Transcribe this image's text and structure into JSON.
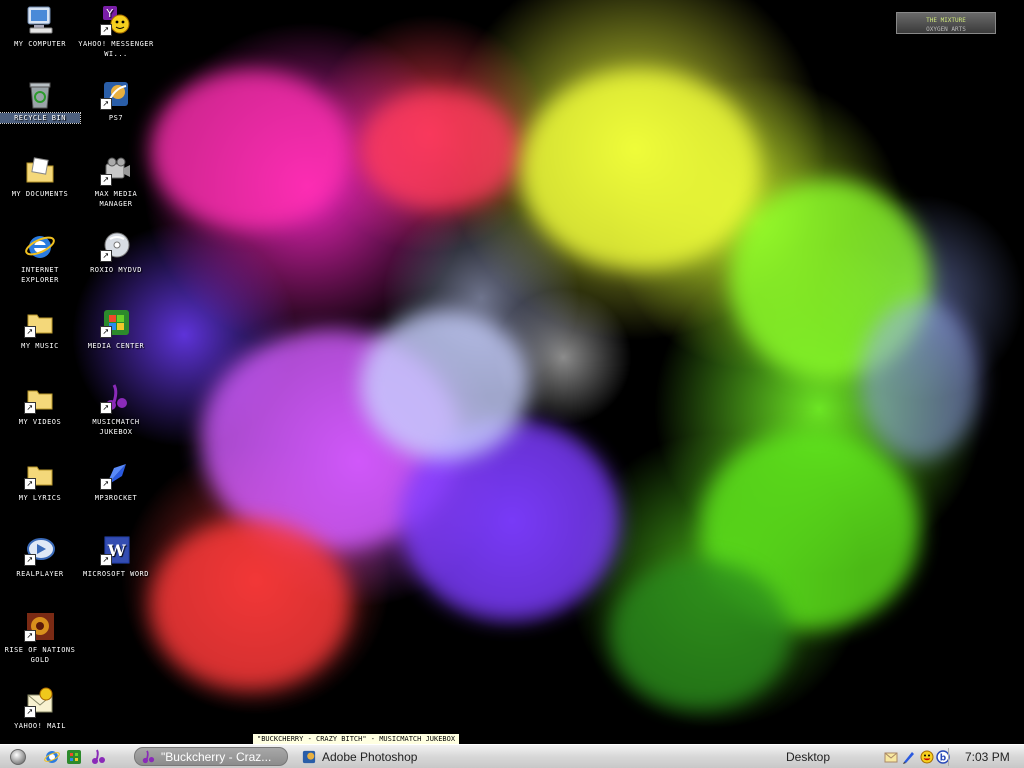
{
  "desktop": {
    "icons": [
      {
        "label": "MY COMPUTER",
        "icon": "computer-icon",
        "shortcut": false
      },
      {
        "label": "YAHOO! MESSENGER WI...",
        "icon": "yahoo-messenger-icon",
        "shortcut": true
      },
      {
        "label": "RECYCLE BIN",
        "icon": "recycle-bin-icon",
        "shortcut": false
      },
      {
        "label": "PS7",
        "icon": "photoshop-icon",
        "shortcut": true
      },
      {
        "label": "MY DOCUMENTS",
        "icon": "folder-documents-icon",
        "shortcut": false
      },
      {
        "label": "MAX MEDIA MANAGER",
        "icon": "media-manager-icon",
        "shortcut": true
      },
      {
        "label": "INTERNET EXPLORER",
        "icon": "internet-explorer-icon",
        "shortcut": false
      },
      {
        "label": "ROXIO MYDVD",
        "icon": "dvd-icon",
        "shortcut": true
      },
      {
        "label": "MY MUSIC",
        "icon": "folder-icon",
        "shortcut": true
      },
      {
        "label": "MEDIA CENTER",
        "icon": "media-center-icon",
        "shortcut": true
      },
      {
        "label": "MY VIDEOS",
        "icon": "folder-icon",
        "shortcut": true
      },
      {
        "label": "MUSICMATCH JUKEBOX",
        "icon": "musicmatch-icon",
        "shortcut": true
      },
      {
        "label": "MY LYRICS",
        "icon": "folder-icon",
        "shortcut": true
      },
      {
        "label": "MP3ROCKET",
        "icon": "mp3rocket-icon",
        "shortcut": true
      },
      {
        "label": "REALPLAYER",
        "icon": "realplayer-icon",
        "shortcut": true
      },
      {
        "label": "MICROSOFT WORD",
        "icon": "word-icon",
        "shortcut": true
      },
      {
        "label": "RISE OF NATIONS GOLD",
        "icon": "game-icon",
        "shortcut": true
      },
      {
        "label": "YAHOO! MAIL",
        "icon": "yahoo-mail-icon",
        "shortcut": true
      }
    ],
    "logo": {
      "title": "THE MIXTURE",
      "subtitle": "OXYGEN ARTS"
    }
  },
  "tooltip": "\"BUCKCHERRY - CRAZY BITCH\" - MUSICMATCH JUKEBOX",
  "taskbar": {
    "start_icon": "start-orb-icon",
    "quick_launch": [
      "internet-explorer-icon",
      "media-center-icon",
      "musicmatch-icon"
    ],
    "tasks": [
      {
        "label": "\"Buckcherry - Craz...",
        "icon": "musicmatch-icon",
        "active": true
      },
      {
        "label": "Adobe Photoshop",
        "icon": "photoshop-icon",
        "active": false
      }
    ],
    "desktop_toolbar": "Desktop",
    "tray_icons": [
      "mail-icon",
      "pen-icon",
      "smiley-icon",
      "smiley-2-icon",
      "info-icon"
    ],
    "clock": "7:03 PM"
  }
}
